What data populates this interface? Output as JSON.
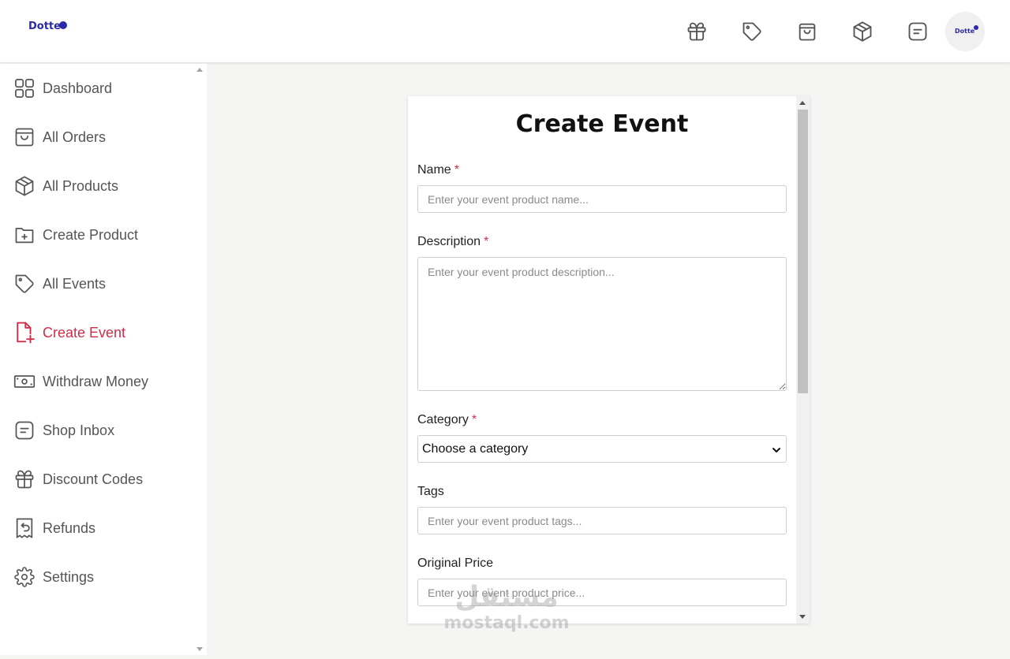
{
  "header": {
    "logo_text": "Dotte",
    "avatar_text": "Dotte",
    "icons": [
      "gift-icon",
      "tag-icon",
      "shopping-bag-icon",
      "package-icon",
      "message-icon"
    ]
  },
  "sidebar": {
    "items": [
      {
        "label": "Dashboard",
        "icon": "grid-icon"
      },
      {
        "label": "All Orders",
        "icon": "shopping-bag-icon"
      },
      {
        "label": "All Products",
        "icon": "package-icon"
      },
      {
        "label": "Create Product",
        "icon": "folder-plus-icon"
      },
      {
        "label": "All Events",
        "icon": "tag-icon"
      },
      {
        "label": "Create Event",
        "icon": "file-plus-icon",
        "active": true
      },
      {
        "label": "Withdraw Money",
        "icon": "money-icon"
      },
      {
        "label": "Shop Inbox",
        "icon": "message-icon"
      },
      {
        "label": "Discount Codes",
        "icon": "gift-icon"
      },
      {
        "label": "Refunds",
        "icon": "receipt-refund-icon"
      },
      {
        "label": "Settings",
        "icon": "gear-icon"
      }
    ]
  },
  "form": {
    "title": "Create Event",
    "required_mark": "*",
    "name": {
      "label": "Name",
      "placeholder": "Enter your event product name..."
    },
    "description": {
      "label": "Description",
      "placeholder": "Enter your event product description..."
    },
    "category": {
      "label": "Category",
      "selected": "Choose a category"
    },
    "tags": {
      "label": "Tags",
      "placeholder": "Enter your event product tags..."
    },
    "original_price": {
      "label": "Original Price",
      "placeholder": "Enter your event product price..."
    }
  },
  "watermark": {
    "arabic": "مستقل",
    "latin": "mostaql.com"
  },
  "colors": {
    "accent": "#d02d4b",
    "brand": "#2a2aa8",
    "nav_text": "#555555"
  }
}
